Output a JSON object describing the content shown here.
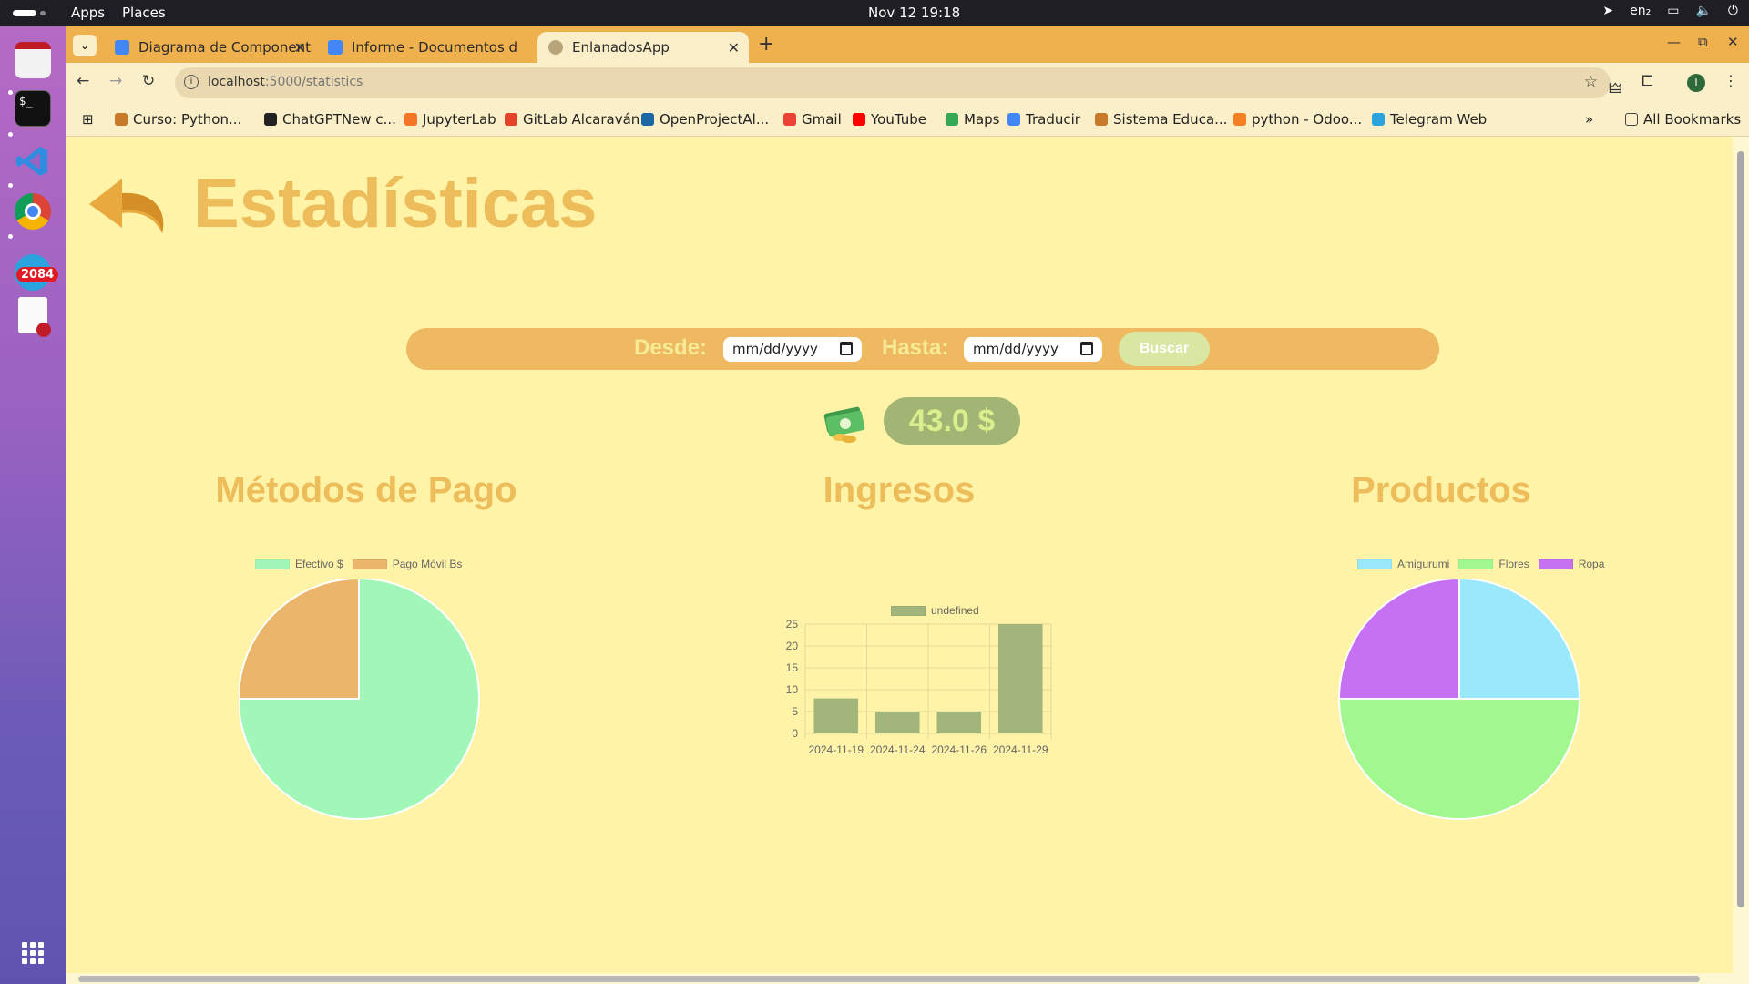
{
  "topbar": {
    "apps": "Apps",
    "places": "Places",
    "clock": "Nov 12  19:18",
    "lang": "en₂"
  },
  "dock": {
    "badge": "2084",
    "apps": [
      "files-icon",
      "terminal-icon",
      "vscode-icon",
      "chrome-icon",
      "telegram-icon",
      "text-editor-icon"
    ]
  },
  "browser": {
    "tabs": [
      {
        "title": "Diagrama de Component",
        "icon": "google-drive-icon",
        "color": "#4285f4"
      },
      {
        "title": "Informe - Documentos d",
        "icon": "google-docs-icon",
        "color": "#4285f4"
      },
      {
        "title": "EnlanadosApp",
        "icon": "yarn-icon",
        "color": "#7a6a4a"
      }
    ],
    "url_host": "localhost",
    "url_path": ":5000/statistics",
    "profile_initial": "I",
    "bookmarks": [
      {
        "label": "Curso: Python...",
        "color": "#c77a2a"
      },
      {
        "label": "ChatGPTNew c...",
        "color": "#222222"
      },
      {
        "label": "JupyterLab",
        "color": "#f37626"
      },
      {
        "label": "GitLab Alcaraván",
        "color": "#e24329"
      },
      {
        "label": "OpenProjectAl...",
        "color": "#1a67a3"
      },
      {
        "label": "Gmail",
        "color": "#ea4335"
      },
      {
        "label": "YouTube",
        "color": "#ff0000"
      },
      {
        "label": "Maps",
        "color": "#34a853"
      },
      {
        "label": "Traducir",
        "color": "#4285f4"
      },
      {
        "label": "Sistema Educa...",
        "color": "#c77a2a"
      },
      {
        "label": "python - Odoo...",
        "color": "#f48024"
      },
      {
        "label": "Telegram Web",
        "color": "#2aa3df"
      }
    ],
    "all_bookmarks": "All Bookmarks"
  },
  "page": {
    "title": "Estadísticas",
    "desde_label": "Desde:",
    "hasta_label": "Hasta:",
    "date_placeholder": "mm/dd/yyyy",
    "search_button": "Buscar",
    "total": "43.0 $",
    "titles": {
      "payment": "Métodos de Pago",
      "income": "Ingresos",
      "products": "Productos"
    }
  },
  "colors": {
    "accent": "#edbd5b",
    "page_bg": "#fef3a6"
  },
  "chart_data": [
    {
      "type": "pie",
      "title": "Métodos de Pago",
      "legend_position": "top",
      "labels": [
        "Efectivo $",
        "Pago Móvil Bs"
      ],
      "values": [
        75,
        25
      ],
      "colors": [
        "#a1f7b8",
        "#ebb56c"
      ]
    },
    {
      "type": "bar",
      "title": "Ingresos",
      "legend_position": "top",
      "categories": [
        "2024-11-19",
        "2024-11-24",
        "2024-11-26",
        "2024-11-29"
      ],
      "series": [
        {
          "name": "undefined",
          "values": [
            8,
            5,
            5,
            25
          ],
          "color": "#a2b57a"
        }
      ],
      "ylim": [
        0,
        25
      ],
      "yticks": [
        0,
        5,
        10,
        15,
        20,
        25
      ],
      "grid": true
    },
    {
      "type": "pie",
      "title": "Productos",
      "legend_position": "top",
      "labels": [
        "Amigurumi",
        "Flores",
        "Ropa"
      ],
      "values": [
        25,
        50,
        25
      ],
      "colors": [
        "#9ae9fa",
        "#a1f88e",
        "#c670f2"
      ]
    }
  ]
}
